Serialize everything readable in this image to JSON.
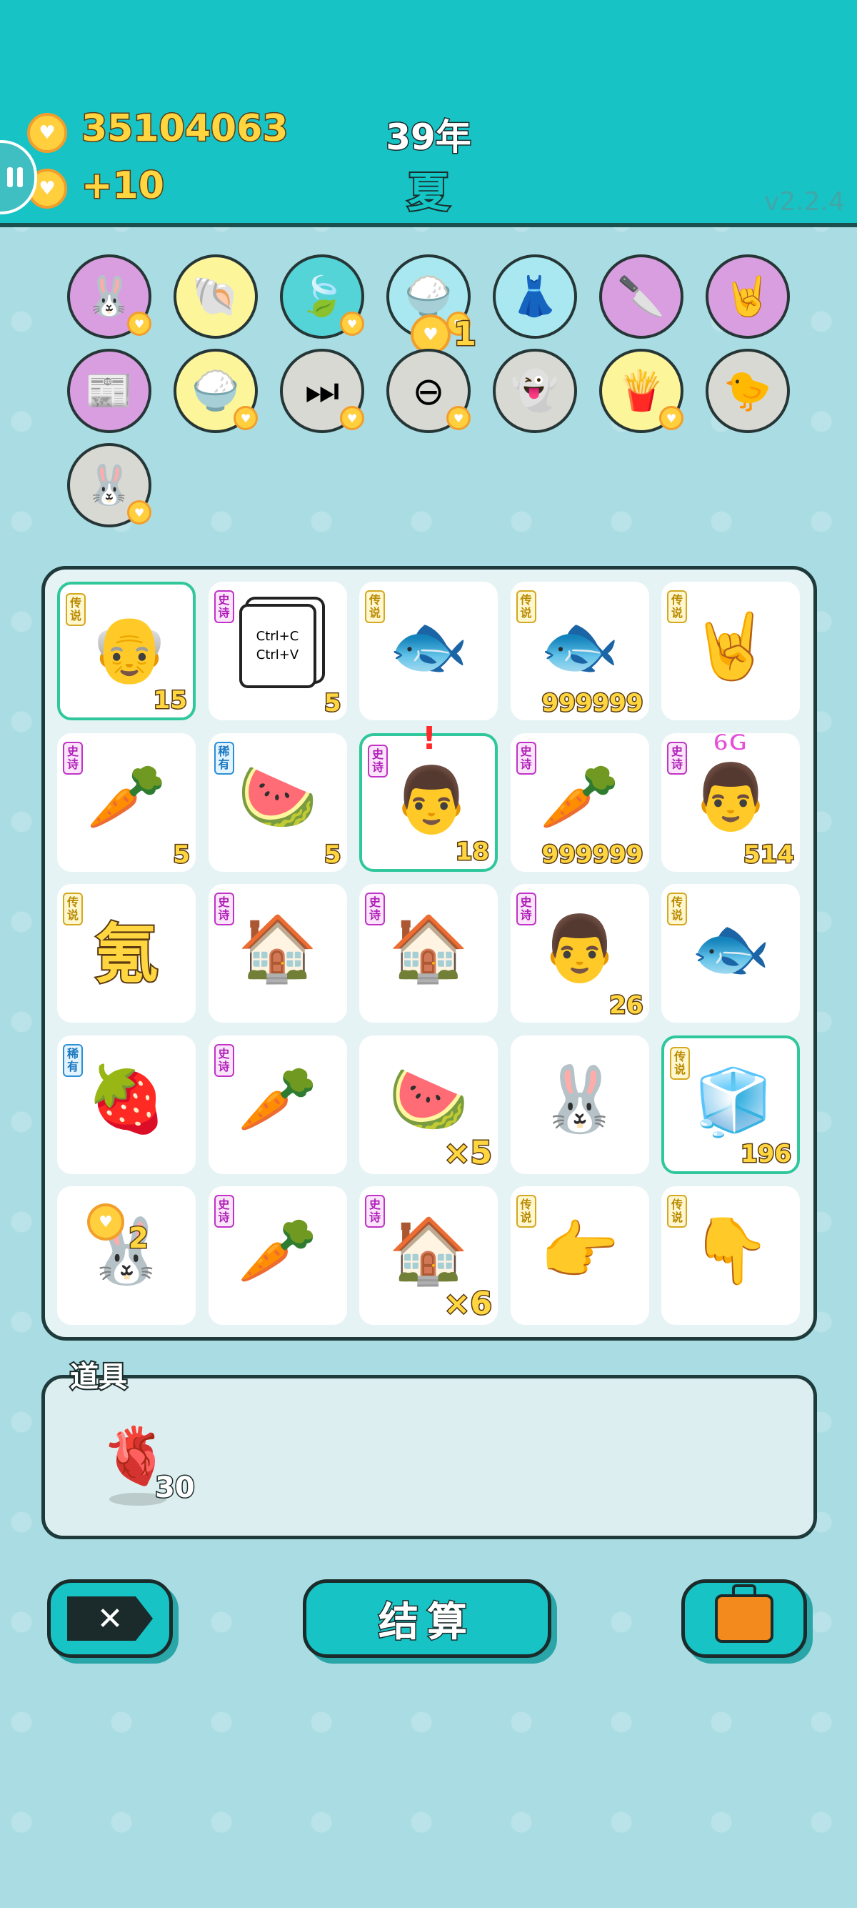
{
  "header": {
    "coins": "35104063",
    "coin_delta": "+10",
    "year": "39年",
    "season": "夏",
    "version": "v2.2.4"
  },
  "relics": [
    {
      "name": "rabbit-icon",
      "glyph": "🐰",
      "bg": "#d89ee0",
      "heart": true
    },
    {
      "name": "shell-icon",
      "glyph": "🐚",
      "bg": "#fdf59a",
      "heart": false
    },
    {
      "name": "leaf-icon",
      "glyph": "🍃",
      "bg": "#55d4d8",
      "heart": true
    },
    {
      "name": "rice-bowl-icon",
      "glyph": "🍚",
      "bg": "#a9e8f0",
      "heart": true,
      "badge": "1"
    },
    {
      "name": "skirt-icon",
      "glyph": "👗",
      "bg": "#a9e8f0",
      "heart": false
    },
    {
      "name": "cleaver-icon",
      "glyph": "🔪",
      "bg": "#d89ee0",
      "heart": false
    },
    {
      "name": "rock-hand-icon",
      "glyph": "🤘",
      "bg": "#d89ee0",
      "heart": false
    },
    {
      "name": "time-magazine-icon",
      "glyph": "📰",
      "bg": "#d89ee0",
      "heart": false
    },
    {
      "name": "rice-bowl-icon",
      "glyph": "🍚",
      "bg": "#fdf59a",
      "heart": true
    },
    {
      "name": "skip-icon",
      "glyph": "⏭",
      "bg": "#d9d9d4",
      "heart": true
    },
    {
      "name": "minus-icon",
      "glyph": "⊖",
      "bg": "#d9d9d4",
      "heart": true
    },
    {
      "name": "ghost-icon",
      "glyph": "👻",
      "bg": "#d9d9d4",
      "heart": false
    },
    {
      "name": "fries-icon",
      "glyph": "🍟",
      "bg": "#fdf59a",
      "heart": true
    },
    {
      "name": "chick-egg-icon",
      "glyph": "🐤",
      "bg": "#d9d9d4",
      "heart": false
    },
    {
      "name": "rabbit-icon",
      "glyph": "🐰",
      "bg": "#d9d9d4",
      "heart": true
    }
  ],
  "board": [
    {
      "name": "old-man-glasses-icon",
      "glyph": "👴",
      "tag": "传说",
      "rarity": "legend",
      "count": "15",
      "hl": true
    },
    {
      "name": "ctrl-c-v-icon",
      "glyph": "Ctrl+C\nCtrl+V",
      "tag": "史诗",
      "rarity": "epic",
      "count": "5",
      "hl": false
    },
    {
      "name": "koi-fish-icon",
      "glyph": "🐟",
      "tag": "传说",
      "rarity": "legend",
      "count": "",
      "hl": false
    },
    {
      "name": "koi-fish-icon",
      "glyph": "🐟",
      "tag": "传说",
      "rarity": "legend",
      "count": "999999",
      "hl": false
    },
    {
      "name": "rock-hand-icon",
      "glyph": "🤘",
      "tag": "传说",
      "rarity": "legend",
      "count": "",
      "hl": false
    },
    {
      "name": "carrot-icon",
      "glyph": "🥕",
      "tag": "史诗",
      "rarity": "epic",
      "count": "5",
      "hl": false
    },
    {
      "name": "watermelon-icon",
      "glyph": "🍉",
      "tag": "稀有",
      "rarity": "rare",
      "count": "5",
      "hl": false
    },
    {
      "name": "grumpy-man-icon",
      "glyph": "👨",
      "tag": "史诗",
      "rarity": "epic",
      "count": "18",
      "hl": true,
      "alert": "!"
    },
    {
      "name": "carrot-icon",
      "glyph": "🥕",
      "tag": "史诗",
      "rarity": "epic",
      "count": "999999",
      "hl": false
    },
    {
      "name": "grumpy-man-glasses-icon",
      "glyph": "👨",
      "tag": "史诗",
      "rarity": "epic",
      "count": "514",
      "hl": false,
      "top": "6G"
    },
    {
      "name": "krypton-character-icon",
      "glyph": "氪",
      "tag": "传说",
      "rarity": "legend",
      "count": "",
      "hl": false
    },
    {
      "name": "rabbit-house-icon",
      "glyph": "🏠",
      "tag": "史诗",
      "rarity": "epic",
      "count": "",
      "hl": false
    },
    {
      "name": "rabbit-house-icon",
      "glyph": "🏠",
      "tag": "史诗",
      "rarity": "epic",
      "count": "",
      "hl": false
    },
    {
      "name": "grumpy-man-icon",
      "glyph": "👨",
      "tag": "史诗",
      "rarity": "epic",
      "count": "26",
      "hl": false
    },
    {
      "name": "koi-fish-icon",
      "glyph": "🐟",
      "tag": "传说",
      "rarity": "legend",
      "count": "",
      "hl": false
    },
    {
      "name": "lychee-icon",
      "glyph": "🍓",
      "tag": "稀有",
      "rarity": "rare",
      "count": "",
      "hl": false
    },
    {
      "name": "carrot-icon",
      "glyph": "🥕",
      "tag": "史诗",
      "rarity": "epic",
      "count": "",
      "hl": false
    },
    {
      "name": "watermelon-slice-icon",
      "glyph": "🍉",
      "tag": "",
      "rarity": "",
      "count": "×5",
      "hl": false
    },
    {
      "name": "rabbit-icon",
      "glyph": "🐰",
      "tag": "",
      "rarity": "",
      "count": "",
      "hl": false
    },
    {
      "name": "fridge-icon",
      "glyph": "🧊",
      "tag": "传说",
      "rarity": "legend",
      "count": "196",
      "hl": true
    },
    {
      "name": "rabbit-cart-icon",
      "glyph": "🐰",
      "tag": "",
      "rarity": "",
      "count": "",
      "hl": false,
      "coinbadge": "2"
    },
    {
      "name": "carrot-icon",
      "glyph": "🥕",
      "tag": "史诗",
      "rarity": "epic",
      "count": "",
      "hl": false
    },
    {
      "name": "rabbit-house-icon",
      "glyph": "🏠",
      "tag": "史诗",
      "rarity": "epic",
      "count": "×6",
      "hl": false
    },
    {
      "name": "pointing-hand-icon",
      "glyph": "👉",
      "tag": "传说",
      "rarity": "legend",
      "count": "",
      "hl": false
    },
    {
      "name": "pointing-down-hand-icon",
      "glyph": "👇",
      "tag": "传说",
      "rarity": "legend",
      "count": "",
      "hl": false
    }
  ],
  "items": {
    "title": "道具",
    "list": [
      {
        "name": "liver-item-icon",
        "glyph": "🫀",
        "count": "30"
      }
    ]
  },
  "buttons": {
    "settle": "结算"
  }
}
